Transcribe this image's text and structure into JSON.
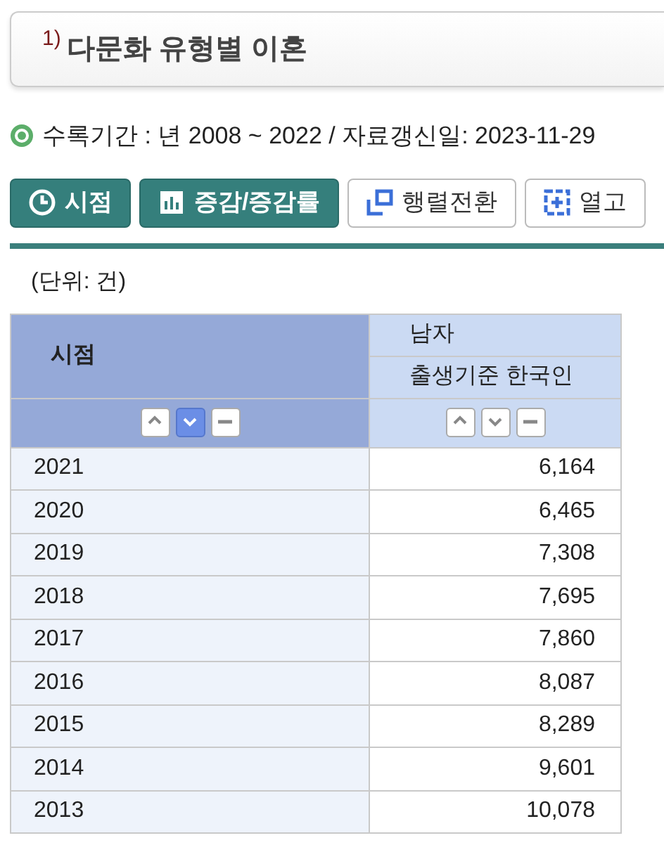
{
  "title": {
    "note": "1)",
    "text": "다문화 유형별 이혼"
  },
  "info": "수록기간 : 년 2008 ~ 2022 / 자료갱신일: 2023-11-29",
  "toolbar": [
    {
      "kind": "primary",
      "label": "시점"
    },
    {
      "kind": "primary",
      "label": "증감/증감률"
    },
    {
      "kind": "secondary",
      "label": "행렬전환"
    },
    {
      "kind": "secondary",
      "label": "열고"
    }
  ],
  "unit": "(단위: 건)",
  "table": {
    "row_header": "시점",
    "column_header": "남자",
    "column_subheader": "출생기준 한국인",
    "sort_buttons": [
      [
        {
          "kind": "up",
          "selected": false
        },
        {
          "kind": "down",
          "selected": true
        },
        {
          "kind": "none",
          "selected": false
        }
      ],
      [
        {
          "kind": "up",
          "selected": false
        },
        {
          "kind": "down",
          "selected": false
        },
        {
          "kind": "none",
          "selected": false
        }
      ]
    ],
    "rows": [
      {
        "year": "2021",
        "value": "6,164"
      },
      {
        "year": "2020",
        "value": "6,465"
      },
      {
        "year": "2019",
        "value": "7,308"
      },
      {
        "year": "2018",
        "value": "7,695"
      },
      {
        "year": "2017",
        "value": "7,860"
      },
      {
        "year": "2016",
        "value": "8,087"
      },
      {
        "year": "2015",
        "value": "8,289"
      },
      {
        "year": "2014",
        "value": "9,601"
      },
      {
        "year": "2013",
        "value": "10,078"
      }
    ]
  }
}
